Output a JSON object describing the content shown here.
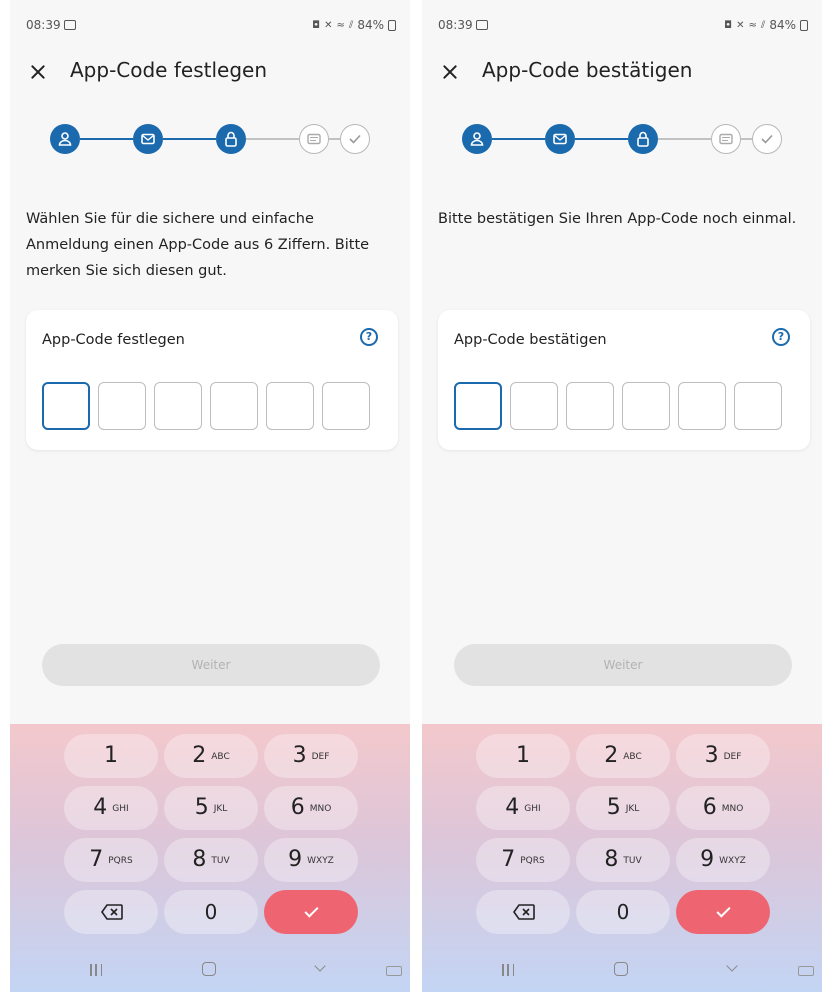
{
  "colors": {
    "accent": "#1b6aae",
    "confirm_key": "#ee6470",
    "disabled_button": "#e2e2e3"
  },
  "screens": [
    {
      "status": {
        "time": "08:39",
        "battery": "84%"
      },
      "header": {
        "title": "App-Code festlegen",
        "close_icon": "close-icon"
      },
      "stepper": {
        "steps": [
          {
            "icon": "person-icon",
            "state": "done"
          },
          {
            "icon": "mail-icon",
            "state": "done"
          },
          {
            "icon": "lock-icon",
            "state": "current"
          },
          {
            "icon": "id-card-icon",
            "state": "todo"
          },
          {
            "icon": "check-icon",
            "state": "todo"
          }
        ]
      },
      "intro": "Wählen Sie für die sichere und einfache Anmeldung einen App-Code aus 6 Ziffern. Bitte merken Sie sich diesen gut.",
      "code_card": {
        "label": "App-Code festlegen",
        "help_icon": "?",
        "digits": 6,
        "filled": 0
      },
      "next_button": "Weiter"
    },
    {
      "status": {
        "time": "08:39",
        "battery": "84%"
      },
      "header": {
        "title": "App-Code bestätigen",
        "close_icon": "close-icon"
      },
      "stepper": {
        "steps": [
          {
            "icon": "person-icon",
            "state": "done"
          },
          {
            "icon": "mail-icon",
            "state": "done"
          },
          {
            "icon": "lock-icon",
            "state": "current"
          },
          {
            "icon": "id-card-icon",
            "state": "todo"
          },
          {
            "icon": "check-icon",
            "state": "todo"
          }
        ]
      },
      "intro": "Bitte bestätigen Sie Ihren App-Code noch einmal.",
      "code_card": {
        "label": "App-Code bestätigen",
        "help_icon": "?",
        "digits": 6,
        "filled": 0
      },
      "next_button": "Weiter"
    }
  ],
  "keypad": {
    "keys": [
      {
        "digit": "1",
        "letters": ""
      },
      {
        "digit": "2",
        "letters": "ABC"
      },
      {
        "digit": "3",
        "letters": "DEF"
      },
      {
        "digit": "4",
        "letters": "GHI"
      },
      {
        "digit": "5",
        "letters": "JKL"
      },
      {
        "digit": "6",
        "letters": "MNO"
      },
      {
        "digit": "7",
        "letters": "PQRS"
      },
      {
        "digit": "8",
        "letters": "TUV"
      },
      {
        "digit": "9",
        "letters": "WXYZ"
      },
      {
        "digit": "backspace",
        "letters": ""
      },
      {
        "digit": "0",
        "letters": ""
      },
      {
        "digit": "confirm",
        "letters": ""
      }
    ]
  },
  "navbar": [
    "recents-icon",
    "home-icon",
    "back-icon",
    "keyboard-icon"
  ]
}
